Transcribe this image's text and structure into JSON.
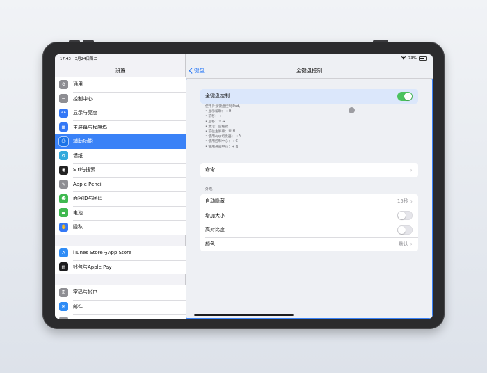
{
  "status": {
    "time": "17:43",
    "date": "3月24日周二",
    "battery": "73%",
    "battery_level": 0.73
  },
  "sidebar": {
    "title": "设置",
    "groups": [
      [
        {
          "label": "通用",
          "icon": "gear-icon",
          "color": "#8e8e93",
          "glyph": "⚙"
        },
        {
          "label": "控制中心",
          "icon": "toggles-icon",
          "color": "#8e8e93",
          "glyph": "☰"
        },
        {
          "label": "显示与亮度",
          "icon": "text-size-icon",
          "color": "#3478f6",
          "glyph": "AA"
        },
        {
          "label": "主屏幕与程序坞",
          "icon": "home-grid-icon",
          "color": "#3478f6",
          "glyph": "▦"
        },
        {
          "label": "辅助功能",
          "icon": "accessibility-icon",
          "color": "#1a73e8",
          "glyph": "☺",
          "active": true
        },
        {
          "label": "墙纸",
          "icon": "flower-icon",
          "color": "#34aadc",
          "glyph": "✿"
        },
        {
          "label": "Siri与搜索",
          "icon": "siri-icon",
          "color": "#222",
          "glyph": "◉"
        },
        {
          "label": "Apple Pencil",
          "icon": "pencil-icon",
          "color": "#8e8e93",
          "glyph": "✎"
        },
        {
          "label": "面容ID与密码",
          "icon": "face-id-icon",
          "color": "#3fb950",
          "glyph": "☻"
        },
        {
          "label": "电池",
          "icon": "battery-icon",
          "color": "#3fb950",
          "glyph": "▬"
        },
        {
          "label": "隐私",
          "icon": "hand-icon",
          "color": "#3478f6",
          "glyph": "✋"
        }
      ],
      [
        {
          "label": "iTunes Store与App Store",
          "icon": "app-store-icon",
          "color": "#2f8cf6",
          "glyph": "A"
        },
        {
          "label": "钱包与Apple Pay",
          "icon": "wallet-icon",
          "color": "#1c1c1e",
          "glyph": "▤"
        }
      ],
      [
        {
          "label": "密码与帐户",
          "icon": "key-icon",
          "color": "#8e8e93",
          "glyph": "⚿"
        },
        {
          "label": "邮件",
          "icon": "mail-icon",
          "color": "#2f8cf6",
          "glyph": "✉"
        },
        {
          "label": "",
          "icon": "contacts-icon",
          "color": "#9a9a9e",
          "glyph": ""
        }
      ]
    ]
  },
  "detail": {
    "back_label": "键盘",
    "title": "全键盘控制",
    "main_toggle": {
      "label": "全键盘控制",
      "on": true
    },
    "description": [
      "使用外接键盘控制iPad。",
      "• 显示帮助：⇥ H",
      "• 前移：⇥",
      "• 后移：⇧ ⇥",
      "• 激活：空格键",
      "• 前往主屏幕：⌘ H",
      "• 使用App切换器：⇥ A",
      "• 使用控制中心：⇥ C",
      "• 使用通知中心：⇥ N"
    ],
    "commands_label": "命令",
    "appearance_section": "外观",
    "appearance_rows": [
      {
        "label": "自动隐藏",
        "value": "15秒",
        "type": "value"
      },
      {
        "label": "增加大小",
        "type": "toggle",
        "on": false
      },
      {
        "label": "高对比度",
        "type": "toggle",
        "on": false
      },
      {
        "label": "颜色",
        "value": "默认",
        "type": "value"
      }
    ]
  }
}
